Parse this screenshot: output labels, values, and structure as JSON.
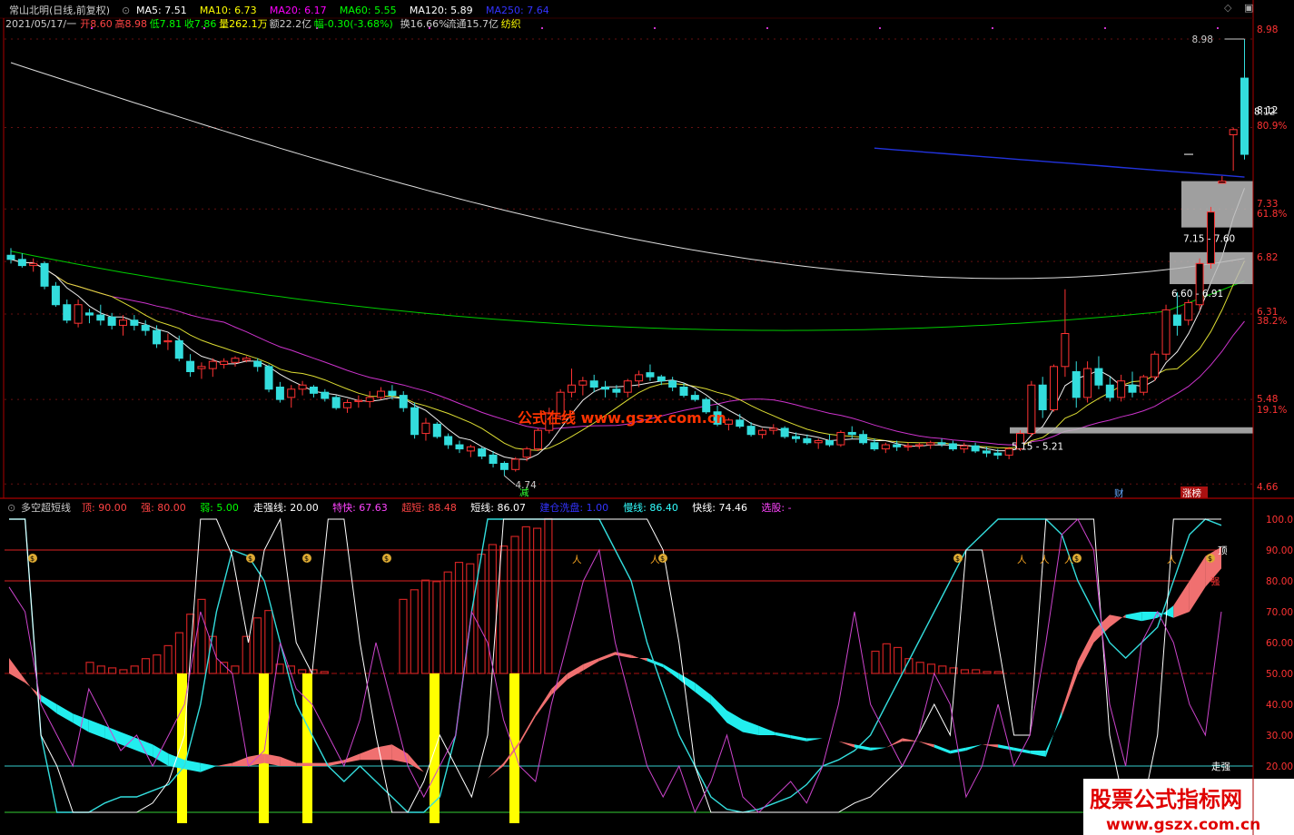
{
  "main_header": {
    "title": "常山北明(日线,前复权)",
    "ma": [
      {
        "label": "MA5: 7.51",
        "color": "#ffffff"
      },
      {
        "label": "MA10: 6.73",
        "color": "#ffff00"
      },
      {
        "label": "MA20: 6.17",
        "color": "#ff00ff"
      },
      {
        "label": "MA60: 5.55",
        "color": "#00ff00"
      },
      {
        "label": "MA120: 5.89",
        "color": "#ffffff"
      },
      {
        "label": "MA250: 7.64",
        "color": "#3333ff"
      }
    ],
    "info": [
      {
        "label": "2021/05/17/一",
        "color": "#cccccc"
      },
      {
        "label": "开8.60",
        "color": "#ff4444"
      },
      {
        "label": "高8.98",
        "color": "#ff4444"
      },
      {
        "label": "低7.81",
        "color": "#00ff00"
      },
      {
        "label": "收7.86",
        "color": "#00ff00"
      },
      {
        "label": "量262.1万",
        "color": "#ffff00"
      },
      {
        "label": "额22.2亿",
        "color": "#cccccc"
      },
      {
        "label": "幅-0.30(-3.68%)",
        "color": "#00ff00"
      },
      {
        "label": "换16.66%",
        "color": "#cccccc"
      },
      {
        "label": "流通15.7亿",
        "color": "#cccccc"
      },
      {
        "label": "纺织",
        "color": "#ffff00"
      }
    ]
  },
  "main_axis": {
    "ticks": [
      "8.98",
      "8.12",
      "80.9%",
      "7.33",
      "61.8%",
      "6.82",
      "6.31",
      "38.2%",
      "5.48",
      "19.1%",
      "4.66"
    ]
  },
  "annotations": {
    "high": "8.98",
    "low": "4.74",
    "box_upper": "7.15 - 7.60",
    "box_lower": "6.60 - 6.91",
    "box_bottom": "5.15 - 5.21",
    "jian": "减",
    "cai": "财",
    "zhangbang": "涨榜",
    "price_mark": "8.12"
  },
  "watermark": "公式在线 www.gszx.com.cn",
  "sub_header": {
    "title": "多空超短线",
    "items": [
      {
        "label": "顶: 90.00",
        "color": "#ff4444"
      },
      {
        "label": "强: 80.00",
        "color": "#ff4444"
      },
      {
        "label": "弱: 5.00",
        "color": "#00ff00"
      },
      {
        "label": "走强线: 20.00",
        "color": "#ffffff"
      },
      {
        "label": "特快: 67.63",
        "color": "#ff44ff"
      },
      {
        "label": "超短: 88.48",
        "color": "#ff4444"
      },
      {
        "label": "短线: 86.07",
        "color": "#ffffff"
      },
      {
        "label": "建仓洗盘: 1.00",
        "color": "#3333ff"
      },
      {
        "label": "慢线: 86.40",
        "color": "#33ffff"
      },
      {
        "label": "快线: 74.46",
        "color": "#ffffff"
      },
      {
        "label": "选股: -",
        "color": "#ff44ff"
      }
    ]
  },
  "sub_axis": {
    "ticks": [
      "100.0",
      "90.00",
      "80.00",
      "70.00",
      "60.00",
      "50.00",
      "40.00",
      "30.00",
      "20.00",
      "10.00"
    ]
  },
  "sub_labels": {
    "ding": "顶",
    "qiang": "强",
    "zouqiang": "走强"
  },
  "corner_logo": {
    "line1": "股票公式指标网",
    "line2": "www.gszx.com.cn"
  },
  "chart_data": [
    {
      "type": "candlestick",
      "title": "常山北明(日线,前复权)",
      "ylim": [
        4.6,
        9.05
      ],
      "candles": [
        [
          6.88,
          6.95,
          6.8,
          6.84
        ],
        [
          6.84,
          6.9,
          6.76,
          6.78
        ],
        [
          6.78,
          6.85,
          6.72,
          6.8
        ],
        [
          6.8,
          6.82,
          6.55,
          6.58
        ],
        [
          6.58,
          6.62,
          6.38,
          6.4
        ],
        [
          6.4,
          6.45,
          6.22,
          6.25
        ],
        [
          6.22,
          6.45,
          6.18,
          6.4
        ],
        [
          6.32,
          6.36,
          6.22,
          6.3
        ],
        [
          6.3,
          6.4,
          6.2,
          6.25
        ],
        [
          6.28,
          6.32,
          6.16,
          6.2
        ],
        [
          6.2,
          6.3,
          6.1,
          6.25
        ],
        [
          6.25,
          6.3,
          6.15,
          6.2
        ],
        [
          6.2,
          6.25,
          6.1,
          6.15
        ],
        [
          6.15,
          6.2,
          5.98,
          6.02
        ],
        [
          6.05,
          6.12,
          5.96,
          6.05
        ],
        [
          6.05,
          6.1,
          5.85,
          5.88
        ],
        [
          5.85,
          5.92,
          5.7,
          5.75
        ],
        [
          5.78,
          5.84,
          5.68,
          5.8
        ],
        [
          5.78,
          5.88,
          5.7,
          5.85
        ],
        [
          5.82,
          5.88,
          5.78,
          5.85
        ],
        [
          5.84,
          5.9,
          5.8,
          5.88
        ],
        [
          5.86,
          5.9,
          5.84,
          5.88
        ],
        [
          5.85,
          5.88,
          5.75,
          5.8
        ],
        [
          5.8,
          5.82,
          5.55,
          5.58
        ],
        [
          5.6,
          5.65,
          5.45,
          5.48
        ],
        [
          5.5,
          5.62,
          5.4,
          5.58
        ],
        [
          5.58,
          5.66,
          5.52,
          5.62
        ],
        [
          5.6,
          5.62,
          5.5,
          5.54
        ],
        [
          5.55,
          5.58,
          5.46,
          5.49
        ],
        [
          5.5,
          5.52,
          5.38,
          5.4
        ],
        [
          5.4,
          5.48,
          5.35,
          5.45
        ],
        [
          5.46,
          5.52,
          5.4,
          5.47
        ],
        [
          5.46,
          5.56,
          5.4,
          5.5
        ],
        [
          5.5,
          5.6,
          5.48,
          5.56
        ],
        [
          5.56,
          5.62,
          5.48,
          5.52
        ],
        [
          5.52,
          5.56,
          5.36,
          5.4
        ],
        [
          5.4,
          5.45,
          5.1,
          5.14
        ],
        [
          5.15,
          5.3,
          5.08,
          5.25
        ],
        [
          5.24,
          5.26,
          5.1,
          5.12
        ],
        [
          5.12,
          5.15,
          5.0,
          5.04
        ],
        [
          5.04,
          5.08,
          4.96,
          5.0
        ],
        [
          4.98,
          5.04,
          4.92,
          5.02
        ],
        [
          5.0,
          5.02,
          4.9,
          4.93
        ],
        [
          4.94,
          4.98,
          4.82,
          4.86
        ],
        [
          4.86,
          4.88,
          4.74,
          4.8
        ],
        [
          4.8,
          4.92,
          4.78,
          4.9
        ],
        [
          4.92,
          5.02,
          4.88,
          5.0
        ],
        [
          5.0,
          5.2,
          4.98,
          5.18
        ],
        [
          5.18,
          5.4,
          5.15,
          5.35
        ],
        [
          5.32,
          5.58,
          5.28,
          5.55
        ],
        [
          5.55,
          5.78,
          5.5,
          5.62
        ],
        [
          5.62,
          5.7,
          5.52,
          5.66
        ],
        [
          5.66,
          5.72,
          5.55,
          5.6
        ],
        [
          5.6,
          5.66,
          5.5,
          5.58
        ],
        [
          5.58,
          5.62,
          5.5,
          5.55
        ],
        [
          5.55,
          5.68,
          5.5,
          5.66
        ],
        [
          5.66,
          5.76,
          5.6,
          5.72
        ],
        [
          5.74,
          5.82,
          5.66,
          5.7
        ],
        [
          5.7,
          5.72,
          5.62,
          5.66
        ],
        [
          5.66,
          5.7,
          5.56,
          5.6
        ],
        [
          5.6,
          5.64,
          5.5,
          5.52
        ],
        [
          5.52,
          5.56,
          5.46,
          5.48
        ],
        [
          5.48,
          5.5,
          5.34,
          5.36
        ],
        [
          5.36,
          5.42,
          5.22,
          5.24
        ],
        [
          5.24,
          5.3,
          5.18,
          5.28
        ],
        [
          5.28,
          5.34,
          5.2,
          5.22
        ],
        [
          5.22,
          5.26,
          5.12,
          5.14
        ],
        [
          5.14,
          5.2,
          5.1,
          5.18
        ],
        [
          5.18,
          5.24,
          5.14,
          5.2
        ],
        [
          5.2,
          5.22,
          5.1,
          5.12
        ],
        [
          5.12,
          5.16,
          5.06,
          5.1
        ],
        [
          5.1,
          5.14,
          5.04,
          5.06
        ],
        [
          5.06,
          5.1,
          5.0,
          5.08
        ],
        [
          5.08,
          5.14,
          5.02,
          5.04
        ],
        [
          5.04,
          5.18,
          5.02,
          5.16
        ],
        [
          5.16,
          5.22,
          5.1,
          5.14
        ],
        [
          5.14,
          5.18,
          5.04,
          5.06
        ],
        [
          5.06,
          5.1,
          4.98,
          5.0
        ],
        [
          5.0,
          5.06,
          4.96,
          5.04
        ],
        [
          5.04,
          5.08,
          4.98,
          5.02
        ],
        [
          5.02,
          5.06,
          4.98,
          5.03
        ],
        [
          5.03,
          5.06,
          5.0,
          5.04
        ],
        [
          5.04,
          5.08,
          5.0,
          5.06
        ],
        [
          5.06,
          5.1,
          5.02,
          5.05
        ],
        [
          5.05,
          5.08,
          4.98,
          5.0
        ],
        [
          5.0,
          5.06,
          4.96,
          5.03
        ],
        [
          5.03,
          5.06,
          4.96,
          4.98
        ],
        [
          4.98,
          5.02,
          4.92,
          4.96
        ],
        [
          4.96,
          5.0,
          4.9,
          4.94
        ],
        [
          4.94,
          5.02,
          4.9,
          5.0
        ],
        [
          5.0,
          5.18,
          4.98,
          5.15
        ],
        [
          5.15,
          5.66,
          5.12,
          5.62
        ],
        [
          5.62,
          5.7,
          5.3,
          5.38
        ],
        [
          5.38,
          5.82,
          5.36,
          5.8
        ],
        [
          5.8,
          6.55,
          5.7,
          6.12
        ],
        [
          5.75,
          5.85,
          5.4,
          5.5
        ],
        [
          5.5,
          5.85,
          5.45,
          5.78
        ],
        [
          5.78,
          5.9,
          5.58,
          5.62
        ],
        [
          5.62,
          5.7,
          5.46,
          5.5
        ],
        [
          5.5,
          5.72,
          5.46,
          5.66
        ],
        [
          5.62,
          5.75,
          5.5,
          5.55
        ],
        [
          5.55,
          5.72,
          5.52,
          5.7
        ],
        [
          5.7,
          5.95,
          5.66,
          5.92
        ],
        [
          5.92,
          6.4,
          5.86,
          6.35
        ],
        [
          6.3,
          6.52,
          6.1,
          6.2
        ],
        [
          6.25,
          6.45,
          6.2,
          6.42
        ],
        [
          6.4,
          6.85,
          6.35,
          6.8
        ],
        [
          6.8,
          7.35,
          6.75,
          7.3
        ],
        [
          7.58,
          7.65,
          7.58,
          7.6
        ],
        [
          8.05,
          8.12,
          7.7,
          8.1
        ],
        [
          8.6,
          8.98,
          7.81,
          7.86
        ]
      ],
      "ma_lines": [
        "MA5",
        "MA10",
        "MA20",
        "MA60",
        "MA120",
        "MA250"
      ],
      "annotations": [
        "8.98",
        "4.74",
        "7.15 - 7.60",
        "6.60 - 6.91",
        "5.15 - 5.21"
      ]
    },
    {
      "type": "line",
      "title": "多空超短线",
      "ylim": [
        0,
        100
      ],
      "reference_lines": {
        "顶": 90,
        "强": 80,
        "弱": 5,
        "走强线": 20,
        "中线": 50
      },
      "series": [
        {
          "name": "快线",
          "color": "#ff7777",
          "values": [
            55,
            48,
            41,
            37,
            34,
            31,
            29,
            27,
            25,
            23,
            20,
            19,
            18,
            20,
            21,
            23,
            24,
            23,
            21,
            21,
            21,
            22,
            24,
            26,
            27,
            24,
            18,
            16,
            15,
            15,
            16,
            21,
            28,
            37,
            45,
            50,
            53,
            55,
            57,
            56,
            54,
            52,
            48,
            44,
            40,
            34,
            31,
            30,
            30,
            29,
            28,
            29,
            28,
            26,
            25,
            26,
            29,
            28,
            26,
            24,
            25,
            27,
            26,
            25,
            24,
            23,
            38,
            54,
            64,
            69,
            68,
            67,
            68,
            72,
            80,
            88,
            91
          ]
        },
        {
          "name": "慢线",
          "color": "#33ffff",
          "values": [
            50,
            47,
            43,
            40,
            37,
            35,
            33,
            31,
            29,
            27,
            24,
            22,
            21,
            20,
            20,
            20,
            21,
            20,
            20,
            20,
            20,
            21,
            22,
            22,
            22,
            21,
            18,
            16,
            15,
            15,
            16,
            20,
            27,
            36,
            43,
            48,
            51,
            54,
            56,
            55,
            55,
            53,
            50,
            47,
            43,
            38,
            35,
            33,
            31,
            30,
            29,
            29,
            28,
            27,
            26,
            26,
            28,
            28,
            27,
            25,
            26,
            27,
            27,
            26,
            25,
            25,
            36,
            50,
            60,
            65,
            69,
            70,
            70,
            68,
            70,
            78,
            84
          ]
        },
        {
          "name": "短线",
          "color": "#ffffff",
          "values": [
            100,
            100,
            30,
            20,
            5,
            5,
            5,
            5,
            5,
            8,
            15,
            30,
            100,
            100,
            88,
            60,
            90,
            100,
            60,
            50,
            100,
            100,
            60,
            30,
            5,
            5,
            15,
            30,
            20,
            10,
            30,
            100,
            100,
            100,
            100,
            100,
            100,
            100,
            100,
            100,
            100,
            90,
            60,
            20,
            5,
            5,
            5,
            5,
            5,
            5,
            5,
            5,
            5,
            8,
            10,
            15,
            20,
            30,
            40,
            30,
            90,
            90,
            60,
            30,
            30,
            100,
            100,
            100,
            100,
            30,
            5,
            5,
            30,
            100,
            100,
            100,
            100,
            100
          ]
        },
        {
          "name": "超短",
          "color": "#ff4444",
          "type": "bar",
          "values": [
            0,
            0,
            0,
            4,
            2,
            2,
            4,
            8,
            10,
            15,
            22,
            32,
            40,
            20,
            0,
            0,
            0,
            30,
            34,
            0,
            0,
            0,
            0,
            0,
            0,
            30,
            34,
            36,
            40,
            42,
            50,
            54,
            56,
            60,
            62,
            64,
            66,
            70,
            74,
            76,
            80,
            84,
            0,
            6,
            4,
            3,
            3,
            2,
            1,
            2,
            0,
            0,
            0,
            0,
            0,
            0,
            0,
            0,
            0,
            0,
            12,
            16,
            14,
            8,
            6,
            5,
            4,
            2,
            2,
            0,
            0,
            0,
            0,
            0,
            0,
            0,
            0,
            0
          ]
        },
        {
          "name": "特快",
          "color": "#ff44ff",
          "values": [
            78,
            70,
            40,
            30,
            20,
            45,
            35,
            25,
            30,
            20,
            30,
            40,
            70,
            55,
            50,
            20,
            25,
            60,
            45,
            40,
            30,
            20,
            35,
            60,
            40,
            20,
            10,
            20,
            30,
            70,
            60,
            35,
            20,
            15,
            40,
            60,
            80,
            90,
            60,
            40,
            20,
            10,
            20,
            5,
            15,
            30,
            10,
            5,
            10,
            15,
            8,
            20,
            40,
            70,
            40,
            30,
            20,
            30,
            50,
            40,
            10,
            20,
            40,
            20,
            30,
            60,
            95,
            100,
            90,
            40,
            20,
            60,
            70,
            60,
            40,
            30,
            70
          ]
        }
      ],
      "signals": {
        "建仓洗盘_bars": [
          7,
          10,
          12,
          17,
          21
        ],
        "tags": [
          "$",
          "$",
          "$",
          "$",
          "人",
          "人$",
          "$",
          "人",
          "人",
          "人$",
          "人",
          "$"
        ]
      }
    }
  ]
}
